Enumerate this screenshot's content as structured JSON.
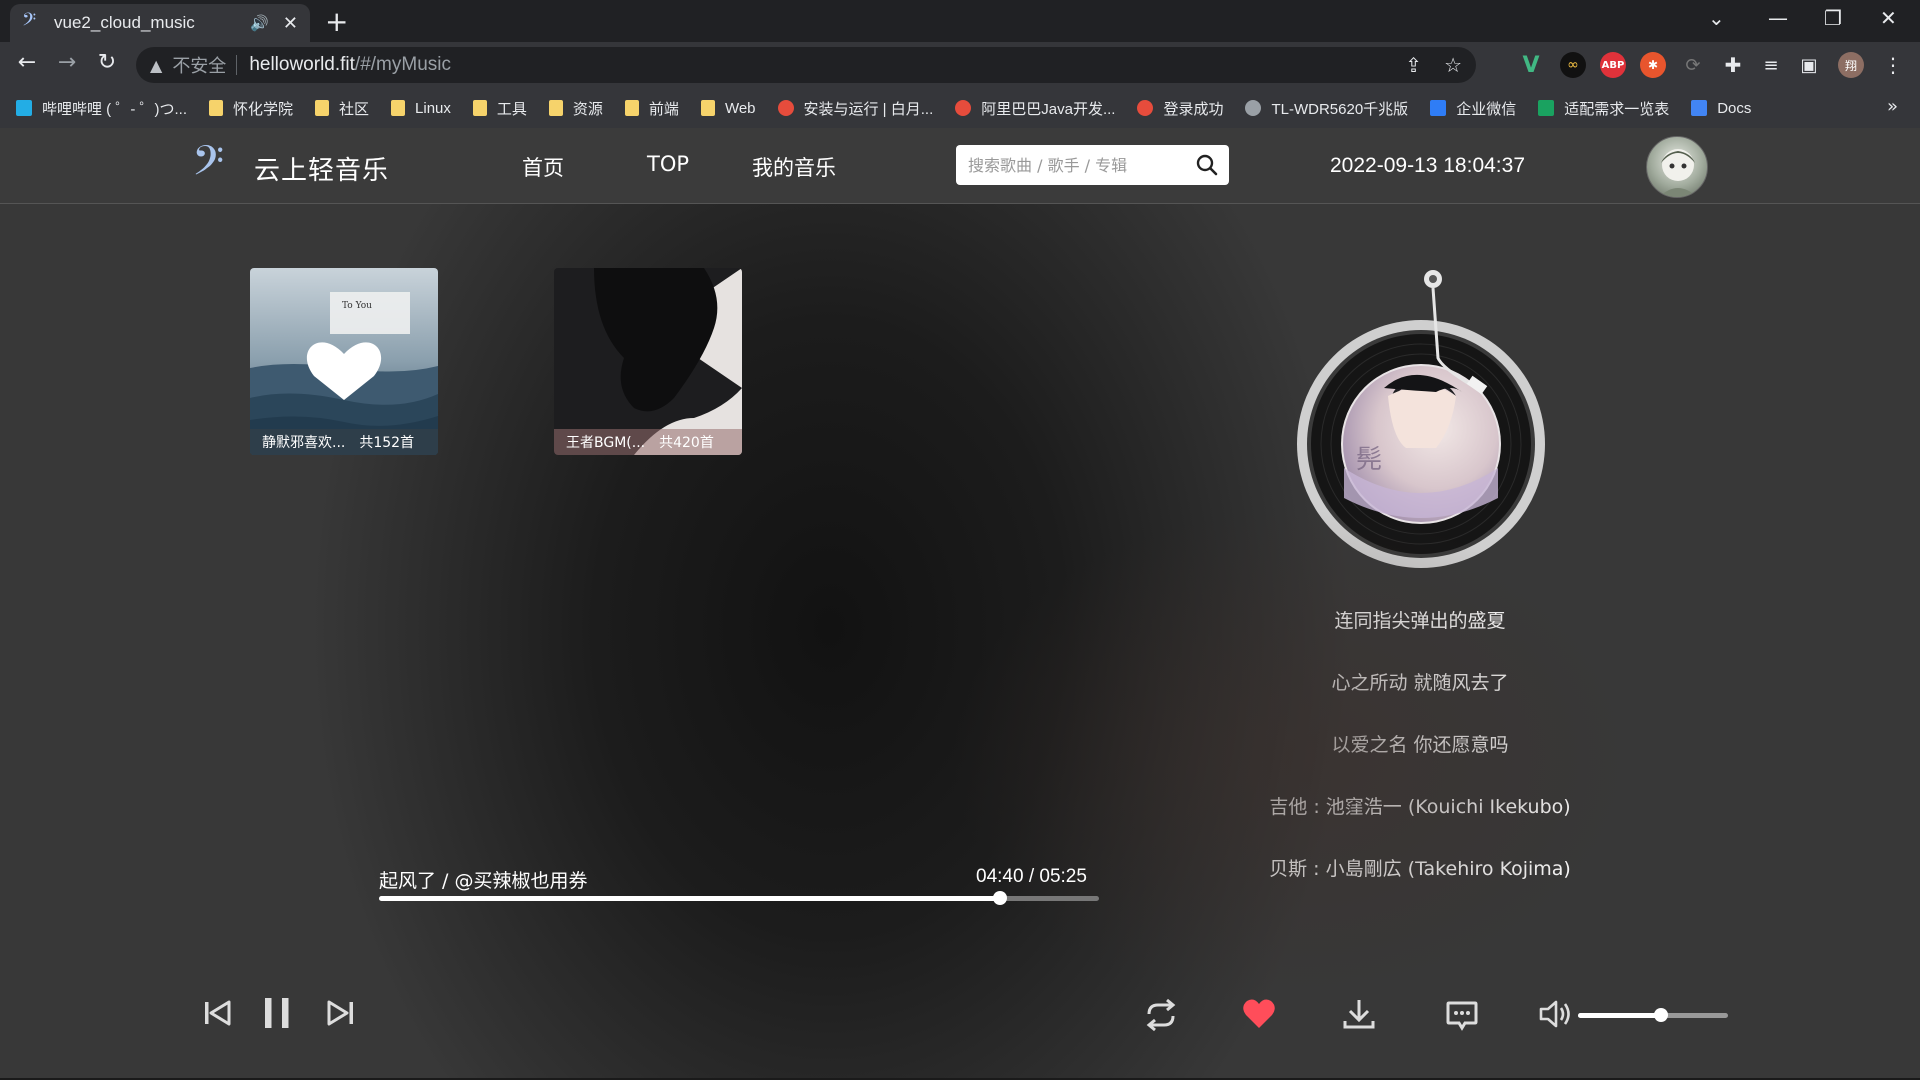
{
  "browser": {
    "tab_title": "vue2_cloud_music",
    "insecure_label": "不安全",
    "url_host": "helloworld.fit",
    "url_path": "/#/myMusic",
    "profile_initial": "翔",
    "bookmarks": [
      {
        "label": "哔哩哔哩 ( ゜- ゜)つ...",
        "icon": "bilibili-icon"
      },
      {
        "label": "怀化学院",
        "icon": "folder-icon"
      },
      {
        "label": "社区",
        "icon": "folder-icon"
      },
      {
        "label": "Linux",
        "icon": "folder-icon"
      },
      {
        "label": "工具",
        "icon": "folder-icon"
      },
      {
        "label": "资源",
        "icon": "folder-icon"
      },
      {
        "label": "前端",
        "icon": "folder-icon"
      },
      {
        "label": "Web",
        "icon": "folder-icon"
      },
      {
        "label": "安装与运行 | 白月...",
        "icon": "site-icon"
      },
      {
        "label": "阿里巴巴Java开发...",
        "icon": "site-icon"
      },
      {
        "label": "登录成功",
        "icon": "site-icon"
      },
      {
        "label": "TL-WDR5620千兆版",
        "icon": "globe-icon"
      },
      {
        "label": "企业微信",
        "icon": "wecom-icon"
      },
      {
        "label": "适配需求一览表",
        "icon": "sheet-icon"
      },
      {
        "label": "Docs",
        "icon": "docs-icon"
      }
    ],
    "overflow_label": "»"
  },
  "header": {
    "logo_text": "云上轻音乐",
    "nav": [
      "首页",
      "TOP",
      "我的音乐"
    ],
    "search_placeholder": "搜索歌曲 / 歌手 / 专辑",
    "datetime": "2022-09-13 18:04:37"
  },
  "playlists": [
    {
      "name": "静默邪喜欢...",
      "count": "共152首"
    },
    {
      "name": "王者BGM(...",
      "count": "共420首"
    }
  ],
  "lyrics": [
    "连同指尖弹出的盛夏",
    "心之所动 就随风去了",
    "以爱之名 你还愿意吗",
    "吉他 : 池窪浩一 (Kouichi Ikekubo)",
    "贝斯 : 小島剛広 (Takehiro Kojima)"
  ],
  "player": {
    "song": "起风了 / @买辣椒也用券",
    "time": "04:40 / 05:25",
    "progress": 0.862,
    "volume": 0.55,
    "liked": true,
    "accent": "#ff4d5a"
  },
  "colors": {
    "header_bg": "#3b3b3b",
    "logo_accent": "#a9c4ec",
    "favorite": "#ff4d5a"
  }
}
